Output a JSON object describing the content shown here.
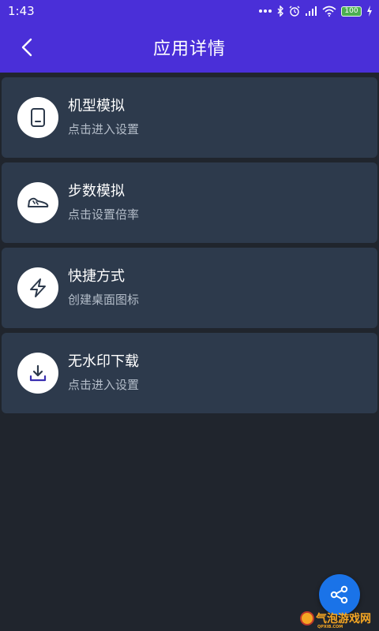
{
  "status_bar": {
    "time": "1:43",
    "battery": "100",
    "icons": [
      "more-icon",
      "bluetooth-icon",
      "alarm-icon",
      "signal-icon",
      "wifi-icon",
      "battery-icon",
      "charging-icon"
    ]
  },
  "app_bar": {
    "title": "应用详情",
    "back_icon": "back-arrow-icon"
  },
  "items": [
    {
      "title": "机型模拟",
      "subtitle": "点击进入设置",
      "icon": "device-icon"
    },
    {
      "title": "步数模拟",
      "subtitle": "点击设置倍率",
      "icon": "shoe-icon"
    },
    {
      "title": "快捷方式",
      "subtitle": "创建桌面图标",
      "icon": "lightning-icon"
    },
    {
      "title": "无水印下载",
      "subtitle": "点击进入设置",
      "icon": "download-icon"
    }
  ],
  "fab": {
    "icon": "share-icon"
  },
  "watermark": {
    "text": "气泡游戏网",
    "sub": "QPXIB.COM"
  },
  "colors": {
    "accent": "#4a2fd8",
    "background": "#20252d",
    "card": "#2d3a4c",
    "fab": "#1a73e8"
  }
}
